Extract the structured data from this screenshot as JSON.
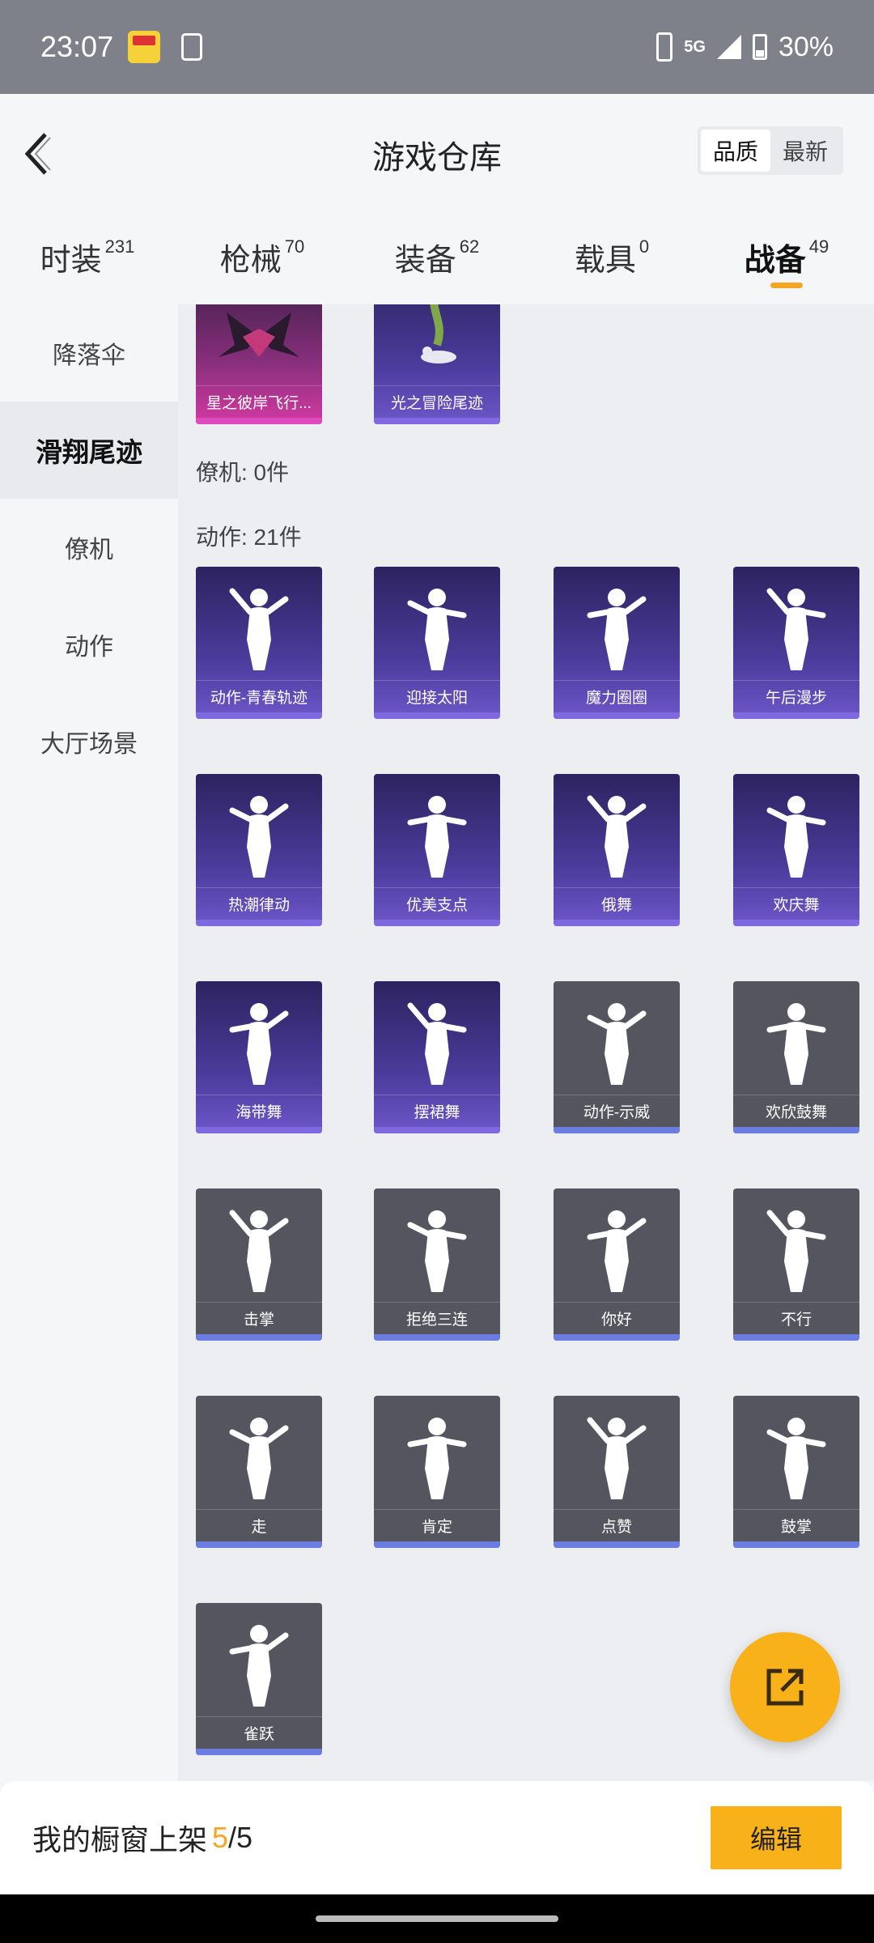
{
  "status_bar": {
    "time": "23:07",
    "network": "5G",
    "battery": "30%"
  },
  "header": {
    "title": "游戏仓库",
    "sort": [
      "品质",
      "最新"
    ]
  },
  "tabs": [
    {
      "label": "时装",
      "count": "231"
    },
    {
      "label": "枪械",
      "count": "70"
    },
    {
      "label": "装备",
      "count": "62"
    },
    {
      "label": "载具",
      "count": "0"
    },
    {
      "label": "战备",
      "count": "49"
    }
  ],
  "sidebar": [
    "降落伞",
    "滑翔尾迹",
    "僚机",
    "动作",
    "大厅场景"
  ],
  "sections": {
    "wingman": "僚机: 0件",
    "actions": "动作: 21件"
  },
  "trail_items": [
    {
      "label": "星之彼岸飞行...",
      "rarity": "pink",
      "icon": "wings-icon"
    },
    {
      "label": "光之冒险尾迹",
      "rarity": "purple",
      "icon": "glide-trail-icon"
    }
  ],
  "action_items": [
    {
      "label": "动作-青春轨迹",
      "rarity": "purple"
    },
    {
      "label": "迎接太阳",
      "rarity": "purple"
    },
    {
      "label": "魔力圈圈",
      "rarity": "purple"
    },
    {
      "label": "午后漫步",
      "rarity": "purple"
    },
    {
      "label": "热潮律动",
      "rarity": "purple"
    },
    {
      "label": "优美支点",
      "rarity": "purple"
    },
    {
      "label": "俄舞",
      "rarity": "purple"
    },
    {
      "label": "欢庆舞",
      "rarity": "purple"
    },
    {
      "label": "海带舞",
      "rarity": "purple"
    },
    {
      "label": "摆裙舞",
      "rarity": "purple"
    },
    {
      "label": "动作-示威",
      "rarity": "gray"
    },
    {
      "label": "欢欣鼓舞",
      "rarity": "gray"
    },
    {
      "label": "击掌",
      "rarity": "gray"
    },
    {
      "label": "拒绝三连",
      "rarity": "gray"
    },
    {
      "label": "你好",
      "rarity": "gray"
    },
    {
      "label": "不行",
      "rarity": "gray"
    },
    {
      "label": "走",
      "rarity": "gray"
    },
    {
      "label": "肯定",
      "rarity": "gray"
    },
    {
      "label": "点赞",
      "rarity": "gray"
    },
    {
      "label": "鼓掌",
      "rarity": "gray"
    },
    {
      "label": "雀跃",
      "rarity": "gray"
    }
  ],
  "bottom": {
    "label": "我的橱窗上架",
    "count": "5",
    "total": "/5",
    "edit": "编辑"
  }
}
